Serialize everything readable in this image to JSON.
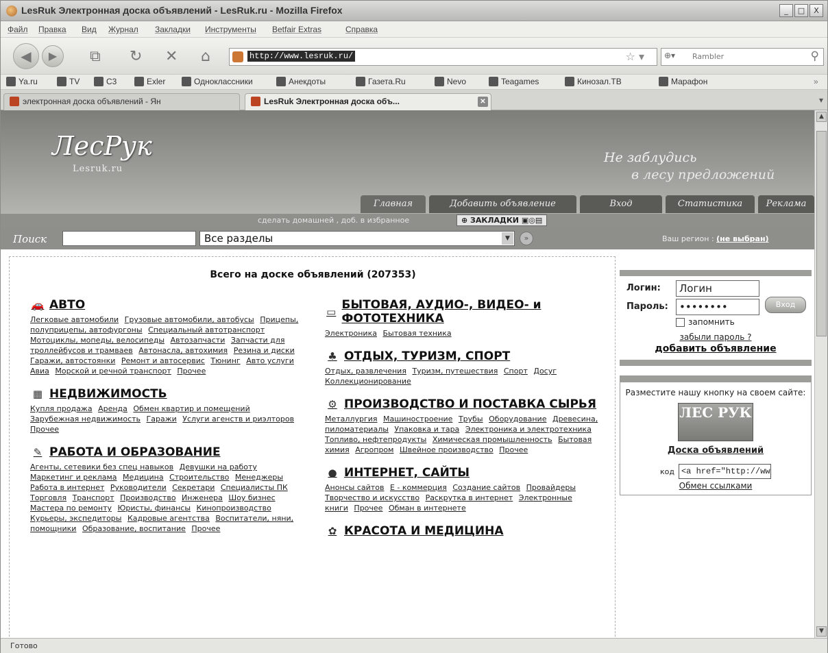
{
  "window": {
    "title": "LesRuk Электронная доска объявлений - LesRuk.ru - Mozilla Firefox",
    "controls": [
      "_",
      "□",
      "X"
    ]
  },
  "menu": [
    "Файл",
    "Правка",
    "Вид",
    "Журнал",
    "Закладки",
    "Инструменты",
    "Betfair Extras",
    "Справка"
  ],
  "toolbar": {
    "url": "http://www.lesruk.ru/",
    "search_engine_placeholder": "Rambler"
  },
  "bookmarks": [
    "Ya.ru",
    "TV",
    "C3",
    "Exler",
    "Одноклассники",
    "Анекдоты",
    "Газета.Ru",
    "Nevo",
    "Teagames",
    "Кинозал.ТВ",
    "Марафон"
  ],
  "tabs": [
    {
      "label": "электронная доска объявлений - Ян"
    },
    {
      "label": "LesRuk Электронная доска объ..."
    }
  ],
  "site": {
    "logo": "ЛесРук",
    "logo_sub": "Lesruk.ru",
    "slogan_line1": "Не заблудись",
    "slogan_line2": "в лесу предложений",
    "nav": [
      "Главная",
      "Добавить объявление",
      "Вход",
      "Статистика",
      "Реклама"
    ],
    "subbar_text": "сделать домашней , доб. в избранное",
    "zakladki": "ЗАКЛАДКИ"
  },
  "search": {
    "label": "Поиск",
    "section": "Все разделы",
    "region_label": "Ваш регион :",
    "region_value": "(не выбран)"
  },
  "main": {
    "total": "Всего на доске объявлений (207353)",
    "left_categories": [
      {
        "title": "АВТО",
        "icon": "car-icon",
        "links": [
          "Легковые автомобили",
          "Грузовые автомобили, автобусы",
          "Прицепы, полуприцепы, автофургоны",
          "Специальный автотранспорт",
          "Мотоциклы, мопеды, велосипеды",
          "Автозапчасти",
          "Запчасти для троллейбусов и трамваев",
          "Автонасла, автохимия",
          "Резина и диски",
          "Гаражи, автостоянки",
          "Ремонт и автосервис",
          "Тюнинг",
          "Авто услуги",
          "Авиа",
          "Морской и речной транспорт",
          "Прочее"
        ]
      },
      {
        "title": "НЕДВИЖИМОСТЬ",
        "icon": "building-icon",
        "links": [
          "Купля продажа",
          "Аренда",
          "Обмен квартир и помещений",
          "Зарубежная недвижимость",
          "Гаражи",
          "Услуги агенств и риэлторов",
          "Прочее"
        ]
      },
      {
        "title": "РАБОТА И ОБРАЗОВАНИЕ",
        "icon": "pen-icon",
        "links": [
          "Агенты, сетевики без спец навыков",
          "Девушки на работу",
          "Маркетинг и реклама",
          "Медицина",
          "Строительство",
          "Менеджеры",
          "Работа в интернет",
          "Руководители",
          "Секретари",
          "Специалисты ПК",
          "Торговля",
          "Транспорт",
          "Производство",
          "Инженера",
          "Шоу бизнес",
          "Мастера по ремонту",
          "Юристы, финансы",
          "Кинопроизводство",
          "Курьеры, экспедиторы",
          "Кадровые агентства",
          "Воспитатели, няни, помощники",
          "Образование, воспитание",
          "Прочее"
        ]
      }
    ],
    "right_categories": [
      {
        "title": "БЫТОВАЯ, АУДИО-, ВИДЕО- и ФОТОТЕХНИКА",
        "icon": "tv-icon",
        "links": [
          "Электроника",
          "Бытовая техника"
        ]
      },
      {
        "title": "ОТДЫХ, ТУРИЗМ, СПОРТ",
        "icon": "palm-icon",
        "links": [
          "Отдых, развлечения",
          "Туризм, путешествия",
          "Спорт",
          "Досуг",
          "Коллекционирование"
        ]
      },
      {
        "title": "ПРОИЗВОДСТВО И ПОСТАВКА СЫРЬЯ",
        "icon": "factory-icon",
        "links": [
          "Металлургия",
          "Машиностроение",
          "Трубы",
          "Оборудование",
          "Древесина, пиломатериалы",
          "Упаковка и тара",
          "Электроника и электротехника",
          "Топливо, нефтепродукты",
          "Химическая промышленность",
          "Бытовая химия",
          "Агропром",
          "Швейное производство",
          "Прочее"
        ]
      },
      {
        "title": "ИНТЕРНЕТ, САЙТЫ",
        "icon": "globe-icon",
        "links": [
          "Анонсы сайтов",
          "E - коммерция",
          "Создание сайтов",
          "Провайдеры",
          "Творчество и искусство",
          "Раскрутка в интернет",
          "Электронные книги",
          "Прочее",
          "Обман в интернете"
        ]
      },
      {
        "title": "КРАСОТА И МЕДИЦИНА",
        "icon": "beauty-icon",
        "links": []
      }
    ]
  },
  "sidebar": {
    "login_label": "Логин:",
    "login_value": "Логин",
    "password_label": "Пароль:",
    "password_value": "••••••••",
    "login_button": "Вход",
    "remember": "запомнить",
    "forgot": "забыли пароль ?",
    "add_ad": "добавить объявление",
    "promo_text": "Разместите нашу кнопку на своем сайте:",
    "promo_logo": "ЛЕС РУК",
    "promo_board": "Доска объявлений",
    "code_label": "код",
    "code_value": "<a href=\"http://ww",
    "exchange": "Обмен ссылками"
  },
  "status": {
    "text": "Готово"
  }
}
